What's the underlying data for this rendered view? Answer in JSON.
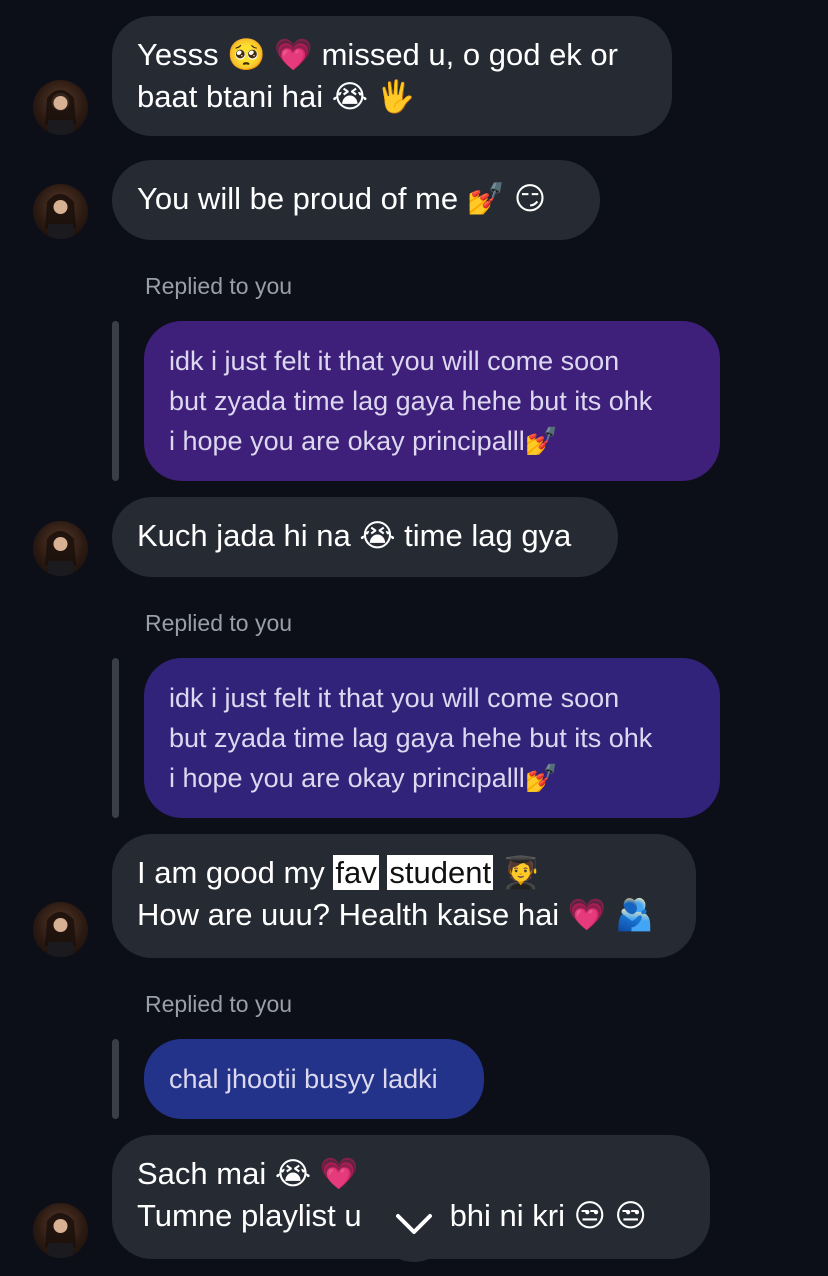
{
  "messages": [
    {
      "lines": [
        "Yesss 🥺 💗  missed u, o god ek or",
        "baat btani hai 😭 🖐"
      ]
    },
    {
      "lines": [
        "You will be proud of me 💅 😏"
      ]
    },
    {
      "replied_label": "Replied to you",
      "reply_lines": [
        "idk i just felt it that you will come soon",
        "but zyada time lag gaya hehe but its ohk",
        "i hope you are okay principalll💅"
      ]
    },
    {
      "lines": [
        "Kuch jada hi na 😭  time lag gya"
      ]
    },
    {
      "replied_label": "Replied to you",
      "reply_lines": [
        "idk i just felt it that you will come soon",
        "but zyada time lag gaya hehe but its ohk",
        "i hope you are okay principalll💅"
      ]
    },
    {
      "line1_prefix": "I am good my ",
      "highlight1": "fav",
      "highlight2": "student",
      "line1_suffix": " 🧑‍🎓",
      "line2": "How are uuu? Health kaise hai 💗 🫂"
    },
    {
      "replied_label": "Replied to you",
      "reply_lines": [
        "chal jhootii busyy ladki"
      ]
    },
    {
      "lines": [
        "Sach mai 😭 💗",
        "Tumne playlist u",
        "bhi ni kri 😒 😒"
      ]
    }
  ],
  "colors": {
    "background": "#0c0f18",
    "incoming_bubble": "#262a33",
    "reply_purple_1": "#3e1f7a",
    "reply_purple_2": "#32237a",
    "reply_blue": "#23338a"
  },
  "icons": {
    "avatar": "profile-photo",
    "scroll_down": "chevron-down-icon"
  }
}
